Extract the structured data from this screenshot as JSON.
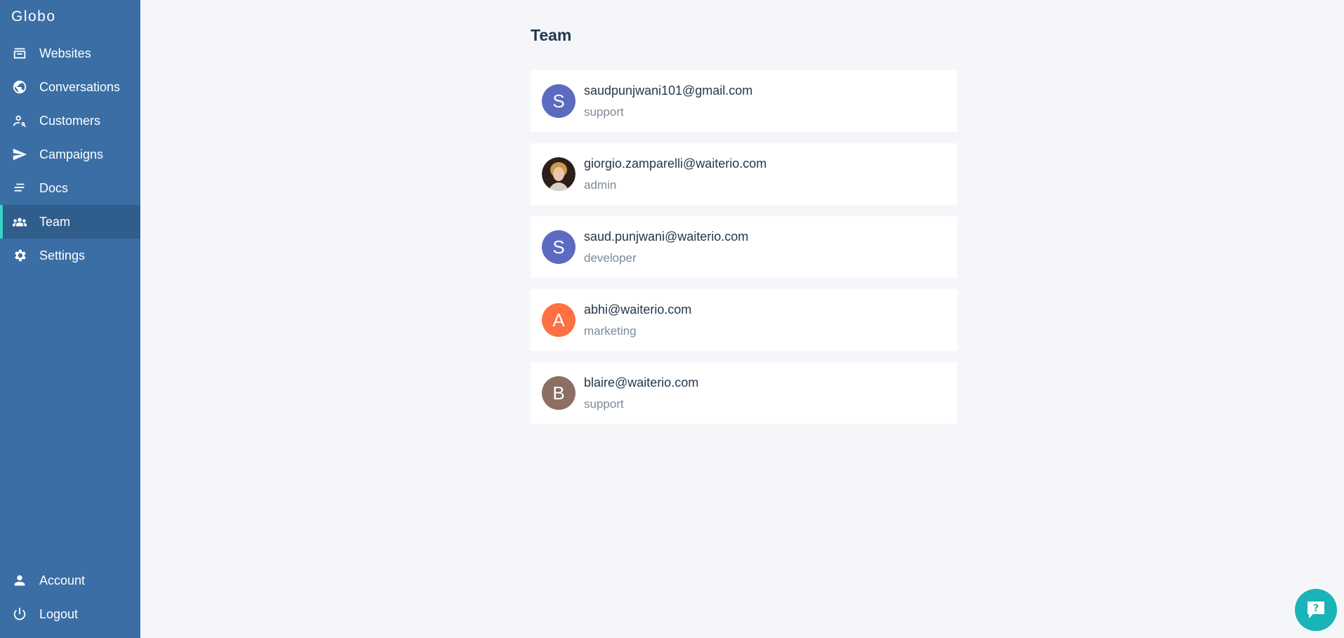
{
  "app": {
    "brand": "Globo"
  },
  "sidebar": {
    "items": [
      {
        "label": "Websites",
        "icon": "websites-icon"
      },
      {
        "label": "Conversations",
        "icon": "globe-icon"
      },
      {
        "label": "Customers",
        "icon": "customer-search-icon"
      },
      {
        "label": "Campaigns",
        "icon": "send-icon"
      },
      {
        "label": "Docs",
        "icon": "docs-lines-icon"
      },
      {
        "label": "Team",
        "icon": "team-icon",
        "active": true
      },
      {
        "label": "Settings",
        "icon": "gear-icon"
      }
    ],
    "bottom_items": [
      {
        "label": "Account",
        "icon": "person-icon"
      },
      {
        "label": "Logout",
        "icon": "power-icon"
      }
    ]
  },
  "main": {
    "title": "Team",
    "members": [
      {
        "email": "saudpunjwani101@gmail.com",
        "role": "support",
        "avatar_letter": "S",
        "avatar_color": "#5c6bc0"
      },
      {
        "email": "giorgio.zamparelli@waiterio.com",
        "role": "admin",
        "avatar_letter": "",
        "avatar_color": "#3a2a22",
        "avatar_type": "photo"
      },
      {
        "email": "saud.punjwani@waiterio.com",
        "role": "developer",
        "avatar_letter": "S",
        "avatar_color": "#5c6bc0"
      },
      {
        "email": "abhi@waiterio.com",
        "role": "marketing",
        "avatar_letter": "A",
        "avatar_color": "#ff7043"
      },
      {
        "email": "blaire@waiterio.com",
        "role": "support",
        "avatar_letter": "B",
        "avatar_color": "#8d6e63"
      }
    ]
  },
  "help_button": {
    "icon": "help-chat-icon",
    "color": "#1ab3b8"
  },
  "colors": {
    "sidebar_bg": "#3a6ea5",
    "sidebar_active_bg": "#2f5d8c",
    "active_indicator": "#38d6c6",
    "page_bg": "#f5f6fa"
  }
}
